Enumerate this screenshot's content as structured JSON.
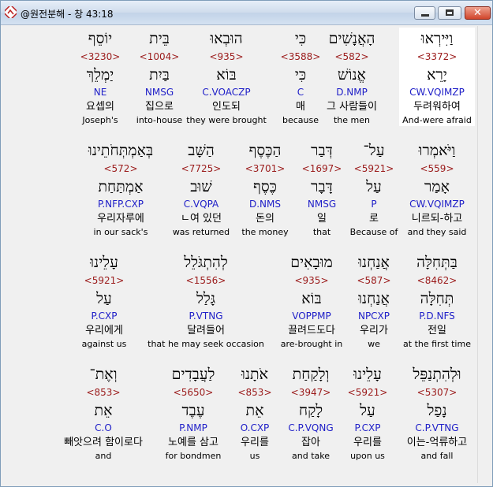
{
  "window": {
    "title": "@원전분해 - 창 43:18",
    "buttons": {
      "minimize": "",
      "maximize": "",
      "close": "✕"
    }
  },
  "rows": [
    [
      {
        "heb": "וַיִּירְאוּ",
        "strong": "<3372>",
        "lemma": "יָרֵא",
        "morph": "CW.VQIMZP",
        "kor": "두려워하여",
        "eng": "And-were afraid",
        "highlight": true
      },
      {
        "heb": "הָאֲנָשִׁים",
        "strong": "<582>",
        "lemma": "אֱנוֹשׁ",
        "morph": "D.NMP",
        "kor": "그 사람들이",
        "eng": "the men"
      },
      {
        "heb": "כִּי",
        "strong": "<3588>",
        "lemma": "כִּי",
        "morph": "C",
        "kor": "매",
        "eng": "because"
      },
      {
        "heb": "הוּבְאוּ",
        "strong": "<935>",
        "lemma": "בּוֹא",
        "morph": "C.VOACZP",
        "kor": "인도되",
        "eng": "they were brought"
      },
      {
        "heb": "בֵּית",
        "strong": "<1004>",
        "lemma": "בַּיִת",
        "morph": "NMSG",
        "kor": "집으로",
        "eng": "into-house"
      },
      {
        "heb": "יוֹסֵף",
        "strong": "<3230>",
        "lemma": "יַמְלֵךְ",
        "morph": "NE",
        "kor": "요셉의",
        "eng": "Joseph's"
      }
    ],
    [
      {
        "heb": "וַיֹּאמְרוּ",
        "strong": "<559>",
        "lemma": "אָמַר",
        "morph": "CW.VQIMZP",
        "kor": "니르되-하고",
        "eng": "and they said"
      },
      {
        "heb": "עַל־",
        "strong": "<5921>",
        "lemma": "עַל",
        "morph": "P",
        "kor": "로",
        "eng": "Because of"
      },
      {
        "heb": "דְּבַר",
        "strong": "<1697>",
        "lemma": "דָּבָר",
        "morph": "NMSG",
        "kor": "일",
        "eng": "that"
      },
      {
        "heb": "הַכֶּסֶף",
        "strong": "<3701>",
        "lemma": "כֶּסֶף",
        "morph": "D.NMS",
        "kor": "돈의",
        "eng": "the money"
      },
      {
        "heb": "הַשָּׁב",
        "strong": "<7725>",
        "lemma": "שׁוּב",
        "morph": "C.VQPA",
        "kor": "ㄴ여 있던",
        "eng": "was returned"
      },
      {
        "heb": "בְּאַמְתְּחֹתֵינוּ",
        "strong": "<572>",
        "lemma": "אַמְתַּחַת",
        "morph": "P.NFP.CXP",
        "kor": "우리자루에",
        "eng": "in our sack's"
      }
    ],
    [
      {
        "heb": "בַּתְּחִלָּה",
        "strong": "<8462>",
        "lemma": "תְּחִלָּה",
        "morph": "P.D.NFS",
        "kor": "전일",
        "eng": "at the first time"
      },
      {
        "heb": "אֲנַחְנוּ",
        "strong": "<587>",
        "lemma": "אֲנַחְנוּ",
        "morph": "NPCXP",
        "kor": "우리가",
        "eng": "we"
      },
      {
        "heb": "מוּבָאִים",
        "strong": "<935>",
        "lemma": "בּוֹא",
        "morph": "VOPPMP",
        "kor": "끌려드도다",
        "eng": "are-brought in"
      },
      {
        "heb": "לְהִתְגֹּלֵל",
        "strong": "<1556>",
        "lemma": "גָּלַל",
        "morph": "P.VTNG",
        "kor": "달려들어",
        "eng": "that he may seek occasion"
      },
      {
        "heb": "עָלֵינוּ",
        "strong": "<5921>",
        "lemma": "עַל",
        "morph": "P.CXP",
        "kor": "우리에게",
        "eng": "against us"
      }
    ],
    [
      {
        "heb": "וּלְהִתְנַפֵּל",
        "strong": "<5307>",
        "lemma": "נָפַל",
        "morph": "C.P.VTNG",
        "kor": "이는-억류하고",
        "eng": "and fall"
      },
      {
        "heb": "עָלֵינוּ",
        "strong": "<5921>",
        "lemma": "עַל",
        "morph": "P.CXP",
        "kor": "우리를",
        "eng": "upon us"
      },
      {
        "heb": "וְלָקַחַת",
        "strong": "<3947>",
        "lemma": "לָקַח",
        "morph": "C.P.VQNG",
        "kor": "잡아",
        "eng": "and take"
      },
      {
        "heb": "אֹתָנוּ",
        "strong": "<853>",
        "lemma": "אֵת",
        "morph": "O.CXP",
        "kor": "우리를",
        "eng": "us"
      },
      {
        "heb": "לַעֲבָדִים",
        "strong": "<5650>",
        "lemma": "עֶבֶד",
        "morph": "P.NMP",
        "kor": "노예를 삼고",
        "eng": "for bondmen"
      },
      {
        "heb": "וְאֶת־",
        "strong": "<853>",
        "lemma": "אֵת",
        "morph": "C.O",
        "kor": "빼앗으려 함이로다",
        "eng": "and"
      }
    ]
  ]
}
